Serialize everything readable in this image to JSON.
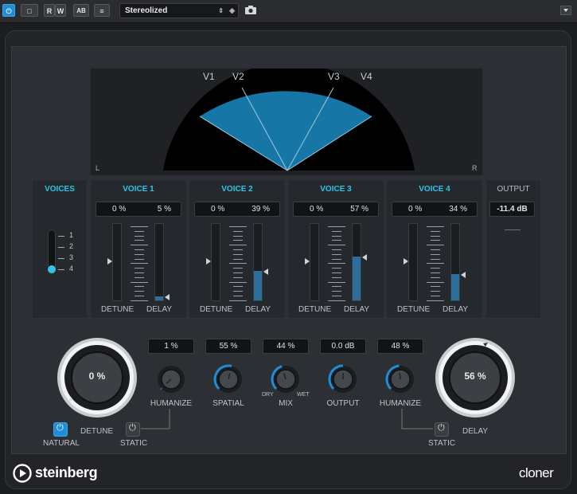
{
  "toolbar": {
    "btn_power": "⏻",
    "btn_compare": "□",
    "btn_read": "R",
    "btn_write": "W",
    "btn_ab": "A",
    "btn_ab2": "B",
    "btn_menu": "≡",
    "preset_name": "Stereolized",
    "accent": "#1f8ed6"
  },
  "display": {
    "voice_labels": [
      "V1",
      "V2",
      "V3",
      "V4"
    ],
    "left": "L",
    "right": "R",
    "fill_color": "#1677a6"
  },
  "voices_section": {
    "title": "VOICES",
    "options": [
      "1",
      "2",
      "3",
      "4"
    ],
    "selected": "4"
  },
  "voice_strips": [
    {
      "title": "VOICE 1",
      "detune": "0 %",
      "delay": "5 %",
      "detune_label": "DETUNE",
      "delay_label": "DELAY",
      "delay_level": 0.05
    },
    {
      "title": "VOICE 2",
      "detune": "0 %",
      "delay": "39 %",
      "detune_label": "DETUNE",
      "delay_label": "DELAY",
      "delay_level": 0.39
    },
    {
      "title": "VOICE 3",
      "detune": "0 %",
      "delay": "57 %",
      "detune_label": "DETUNE",
      "delay_label": "DELAY",
      "delay_level": 0.57
    },
    {
      "title": "VOICE 4",
      "detune": "0 %",
      "delay": "34 %",
      "detune_label": "DETUNE",
      "delay_label": "DELAY",
      "delay_level": 0.34
    }
  ],
  "output_section": {
    "title": "OUTPUT",
    "value": "-11.4 dB"
  },
  "detune_knob": {
    "value": "0 %",
    "label": "DETUNE",
    "natural_label": "NATURAL",
    "static_label": "STATIC"
  },
  "delay_knob": {
    "value": "56 %",
    "label": "DELAY",
    "static_label": "STATIC"
  },
  "params": [
    {
      "value": "1 %",
      "label": "HUMANIZE",
      "level": 0.01
    },
    {
      "value": "55 %",
      "label": "SPATIAL",
      "level": 0.55
    },
    {
      "value": "44 %",
      "label": "MIX",
      "level": 0.44,
      "min_label": "DRY",
      "max_label": "WET"
    },
    {
      "value": "0.0 dB",
      "label": "OUTPUT",
      "level": 0.5
    },
    {
      "value": "48 %",
      "label": "HUMANIZE",
      "level": 0.48
    }
  ],
  "footer": {
    "brand": "steinberg",
    "product": "cloner"
  }
}
